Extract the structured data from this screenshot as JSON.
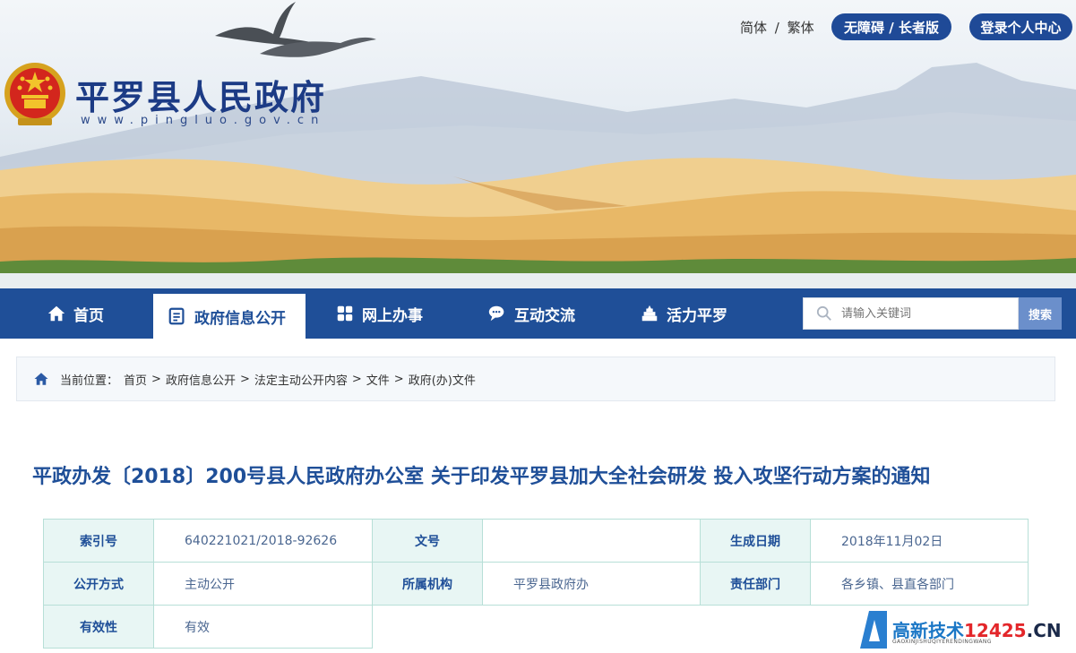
{
  "header": {
    "site_title": "平罗县人民政府",
    "site_url": "www.pingluo.gov.cn",
    "lang_simplified": "简体",
    "lang_sep": "/",
    "lang_traditional": "繁体",
    "accessibility": "无障碍 / 长者版",
    "login": "登录个人中心"
  },
  "nav": {
    "items": [
      {
        "label": "首页",
        "icon": "home-icon"
      },
      {
        "label": "政府信息公开",
        "icon": "document-list-icon",
        "active": true
      },
      {
        "label": "网上办事",
        "icon": "grid-icon"
      },
      {
        "label": "互动交流",
        "icon": "chat-icon"
      },
      {
        "label": "活力平罗",
        "icon": "building-icon"
      }
    ],
    "search_placeholder": "请输入关键词",
    "search_button": "搜索"
  },
  "breadcrumb": {
    "prefix": "当前位置：",
    "items": [
      "首页",
      "政府信息公开",
      "法定主动公开内容",
      "文件",
      "政府(办)文件"
    ],
    "separator": ">"
  },
  "document": {
    "title": "平政办发〔2018〕200号县人民政府办公室 关于印发平罗县加大全社会研发 投入攻坚行动方案的通知"
  },
  "meta": {
    "rows": [
      [
        {
          "k": "索引号",
          "v": "640221021/2018-92626"
        },
        {
          "k": "文号",
          "v": ""
        },
        {
          "k": "生成日期",
          "v": "2018年11月02日"
        }
      ],
      [
        {
          "k": "公开方式",
          "v": "主动公开"
        },
        {
          "k": "所属机构",
          "v": "平罗县政府办"
        },
        {
          "k": "责任部门",
          "v": "各乡镇、县直各部门"
        }
      ],
      [
        {
          "k": "有效性",
          "v": "有效"
        }
      ]
    ]
  },
  "watermark": {
    "brand": "高新技术",
    "number": "12425",
    "domain": ".CN",
    "sub": "GAOXINJISHUQIYERENDINGWANG"
  },
  "colors": {
    "nav_bg": "#1f4f98",
    "title_blue": "#1f4f98",
    "table_border": "#b7dfd7",
    "table_key_bg": "#e8f6f4"
  }
}
